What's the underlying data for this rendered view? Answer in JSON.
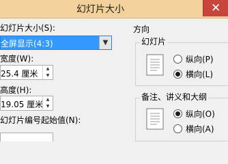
{
  "window": {
    "title": "幻灯片大小",
    "close_glyph": "✕"
  },
  "slide_size": {
    "label": "幻灯片大小(S):",
    "selected": "全屏显示(4:3)",
    "arrow_glyph": "▼"
  },
  "width": {
    "label": "宽度(W):",
    "value": "25.4 厘米"
  },
  "height": {
    "label": "高度(H):",
    "value": "19.05 厘米"
  },
  "numbering": {
    "label": "幻灯片编号起始值(N):"
  },
  "spin": {
    "up_glyph": "▲",
    "down_glyph": "▼"
  },
  "orientation": {
    "title": "方向",
    "slides": {
      "title": "幻灯片",
      "options": [
        {
          "label": "纵向(P)",
          "checked": false
        },
        {
          "label": "横向(L)",
          "checked": true
        }
      ]
    },
    "notes": {
      "title": "备注、讲义和大纲",
      "options": [
        {
          "label": "纵向(O)",
          "checked": true
        },
        {
          "label": "横向(A)",
          "checked": false
        }
      ]
    }
  }
}
